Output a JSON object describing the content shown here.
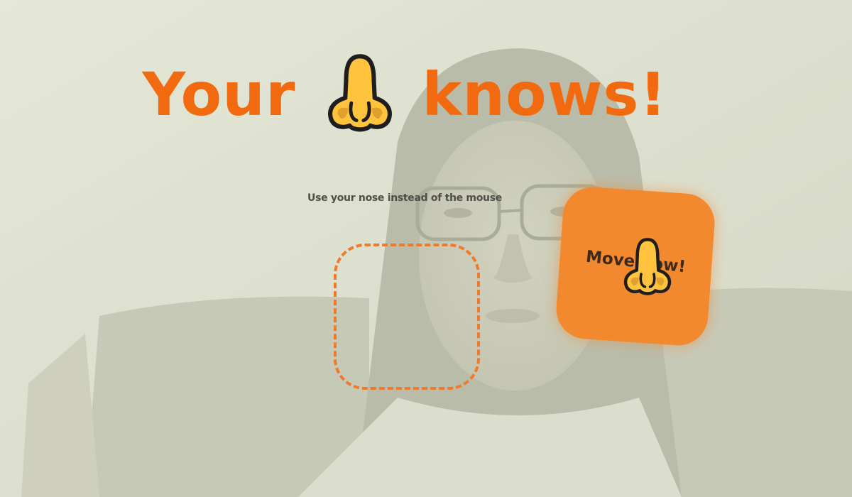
{
  "header": {
    "title_before": "Your",
    "title_icon": "nose-emoji-icon",
    "title_after": "knows!"
  },
  "subtitle": "Use your nose instead of the mouse",
  "target_zone": {
    "style": "dashed-rounded-square"
  },
  "move_button": {
    "label": "Move now!",
    "cursor_icon": "nose-emoji-icon"
  },
  "colors": {
    "accent": "#f26a10",
    "button": "#f2892f",
    "dashed_border": "#f07a2a",
    "nose_fill": "#ffc33d",
    "nose_shade": "#e0a02a",
    "nose_outline": "#1e1e1e",
    "subtitle_text": "#4e4e46"
  }
}
